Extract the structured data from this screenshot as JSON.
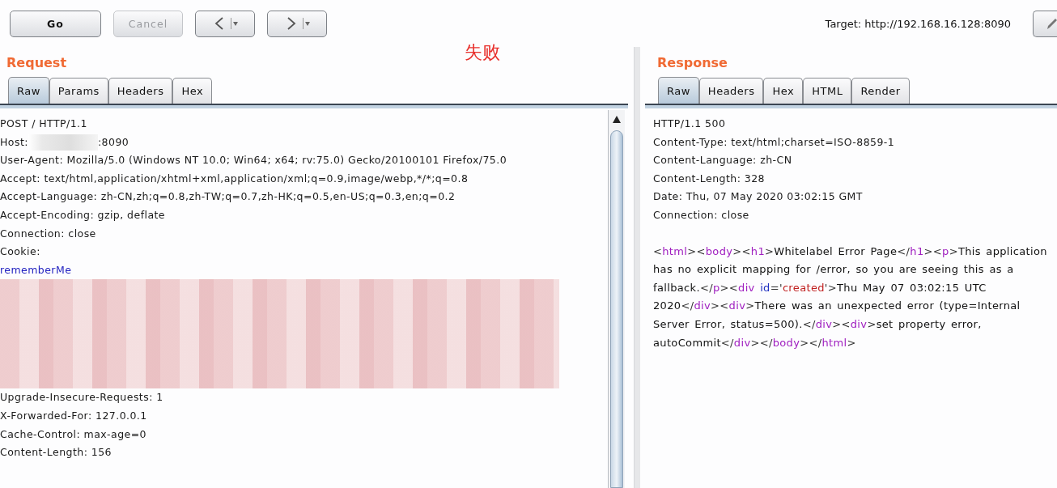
{
  "toolbar": {
    "buttons": [
      {
        "label": "Go",
        "disabled": false
      },
      {
        "label": "Cancel",
        "disabled": true
      }
    ],
    "nav": [
      {
        "kind": "back"
      },
      {
        "kind": "forward"
      }
    ],
    "target": "Target: http://192.168.16.128:8090"
  },
  "annotation": "失败",
  "request": {
    "title": "Request",
    "tabs": [
      {
        "label": "Raw",
        "selected": true
      },
      {
        "label": "Params",
        "selected": false
      },
      {
        "label": "Headers",
        "selected": false
      },
      {
        "label": "Hex",
        "selected": false
      }
    ],
    "lines": [
      {
        "kind": "plain",
        "text": "POST / HTTP/1.1"
      },
      {
        "kind": "masked",
        "before": "Host:",
        "after": ":8090"
      },
      {
        "kind": "plain",
        "text": "User-Agent: Mozilla/5.0 (Windows NT 10.0; Win64; x64; rv:75.0) Gecko/20100101 Firefox/75.0"
      },
      {
        "kind": "plain",
        "text": "Accept: text/html,application/xhtml+xml,application/xml;q=0.9,image/webp,*/*;q=0.8"
      },
      {
        "kind": "plain",
        "text": "Accept-Language: zh-CN,zh;q=0.8,zh-TW;q=0.7,zh-HK;q=0.5,en-US;q=0.3,en;q=0.2"
      },
      {
        "kind": "plain",
        "text": "Accept-Encoding: gzip, deflate"
      },
      {
        "kind": "plain",
        "text": "Connection: close"
      },
      {
        "kind": "plain",
        "text": "Cookie:"
      },
      {
        "kind": "cookie",
        "text": "rememberMe"
      },
      {
        "kind": "redacted"
      },
      {
        "kind": "plain",
        "text": "Upgrade-Insecure-Requests: 1"
      },
      {
        "kind": "plain",
        "text": "X-Forwarded-For: 127.0.0.1"
      },
      {
        "kind": "plain",
        "text": "Cache-Control: max-age=0"
      },
      {
        "kind": "plain",
        "text": "Content-Length: 156"
      }
    ]
  },
  "response": {
    "title": "Response",
    "tabs": [
      {
        "label": "Raw",
        "selected": true
      },
      {
        "label": "Headers",
        "selected": false
      },
      {
        "label": "Hex",
        "selected": false
      },
      {
        "label": "HTML",
        "selected": false
      },
      {
        "label": "Render",
        "selected": false
      }
    ],
    "headers": [
      "HTTP/1.1 500",
      "Content-Type: text/html;charset=ISO-8859-1",
      "Content-Language: zh-CN",
      "Content-Length: 328",
      "Date: Thu, 07 May 2020 03:02:15 GMT",
      "Connection: close"
    ],
    "body": [
      {
        "kind": "punct",
        "text": "<"
      },
      {
        "kind": "tag",
        "text": "html"
      },
      {
        "kind": "punct",
        "text": "><"
      },
      {
        "kind": "tag",
        "text": "body"
      },
      {
        "kind": "punct",
        "text": "><"
      },
      {
        "kind": "tag",
        "text": "h1"
      },
      {
        "kind": "punct",
        "text": ">"
      },
      {
        "kind": "text",
        "text": "Whitelabel Error Page"
      },
      {
        "kind": "punct",
        "text": "</"
      },
      {
        "kind": "tag",
        "text": "h1"
      },
      {
        "kind": "punct",
        "text": "><"
      },
      {
        "kind": "tag",
        "text": "p"
      },
      {
        "kind": "punct",
        "text": ">"
      },
      {
        "kind": "text",
        "text": "This application has no explicit mapping for /error, so you are seeing this as a fallback."
      },
      {
        "kind": "punct",
        "text": "</"
      },
      {
        "kind": "tag",
        "text": "p"
      },
      {
        "kind": "punct",
        "text": "><"
      },
      {
        "kind": "tag",
        "text": "div"
      },
      {
        "kind": "attr",
        "text": " id"
      },
      {
        "kind": "punct",
        "text": "='"
      },
      {
        "kind": "value",
        "text": "created"
      },
      {
        "kind": "punct",
        "text": "'>"
      },
      {
        "kind": "text",
        "text": "Thu May 07 03:02:15 UTC 2020"
      },
      {
        "kind": "punct",
        "text": "</"
      },
      {
        "kind": "tag",
        "text": "div"
      },
      {
        "kind": "punct",
        "text": "><"
      },
      {
        "kind": "tag",
        "text": "div"
      },
      {
        "kind": "punct",
        "text": ">"
      },
      {
        "kind": "text",
        "text": "There was an unexpected error (type=Internal Server Error, status=500)."
      },
      {
        "kind": "punct",
        "text": "</"
      },
      {
        "kind": "tag",
        "text": "div"
      },
      {
        "kind": "punct",
        "text": "><"
      },
      {
        "kind": "tag",
        "text": "div"
      },
      {
        "kind": "punct",
        "text": ">"
      },
      {
        "kind": "text",
        "text": "set property error, autoCommit"
      },
      {
        "kind": "punct",
        "text": "</"
      },
      {
        "kind": "tag",
        "text": "div"
      },
      {
        "kind": "punct",
        "text": "></"
      },
      {
        "kind": "tag",
        "text": "body"
      },
      {
        "kind": "punct",
        "text": "></"
      },
      {
        "kind": "tag",
        "text": "html"
      },
      {
        "kind": "punct",
        "text": ">"
      }
    ]
  }
}
